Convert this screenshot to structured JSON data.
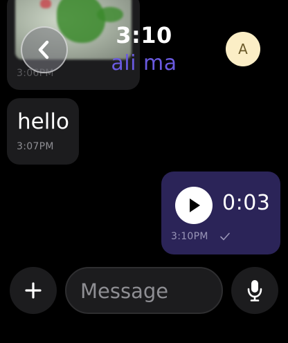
{
  "header": {
    "time": "3:10",
    "contact_name": "ali ma",
    "avatar_initial": "A",
    "back_icon": "chevron-left-icon"
  },
  "messages": [
    {
      "type": "image",
      "direction": "incoming",
      "timestamp": "3:06PM"
    },
    {
      "type": "text",
      "direction": "incoming",
      "text": "hello",
      "timestamp": "3:07PM"
    },
    {
      "type": "voice",
      "direction": "outgoing",
      "duration": "0:03",
      "timestamp": "3:10PM",
      "status_icon": "check-icon"
    }
  ],
  "composer": {
    "placeholder": "Message",
    "add_icon": "plus-icon",
    "mic_icon": "microphone-icon"
  },
  "colors": {
    "background": "#000000",
    "incoming_bubble": "#1c1c1e",
    "outgoing_bubble": "#2b2458",
    "accent_name": "#6a5ae0",
    "avatar_bg": "#fbeec6"
  }
}
